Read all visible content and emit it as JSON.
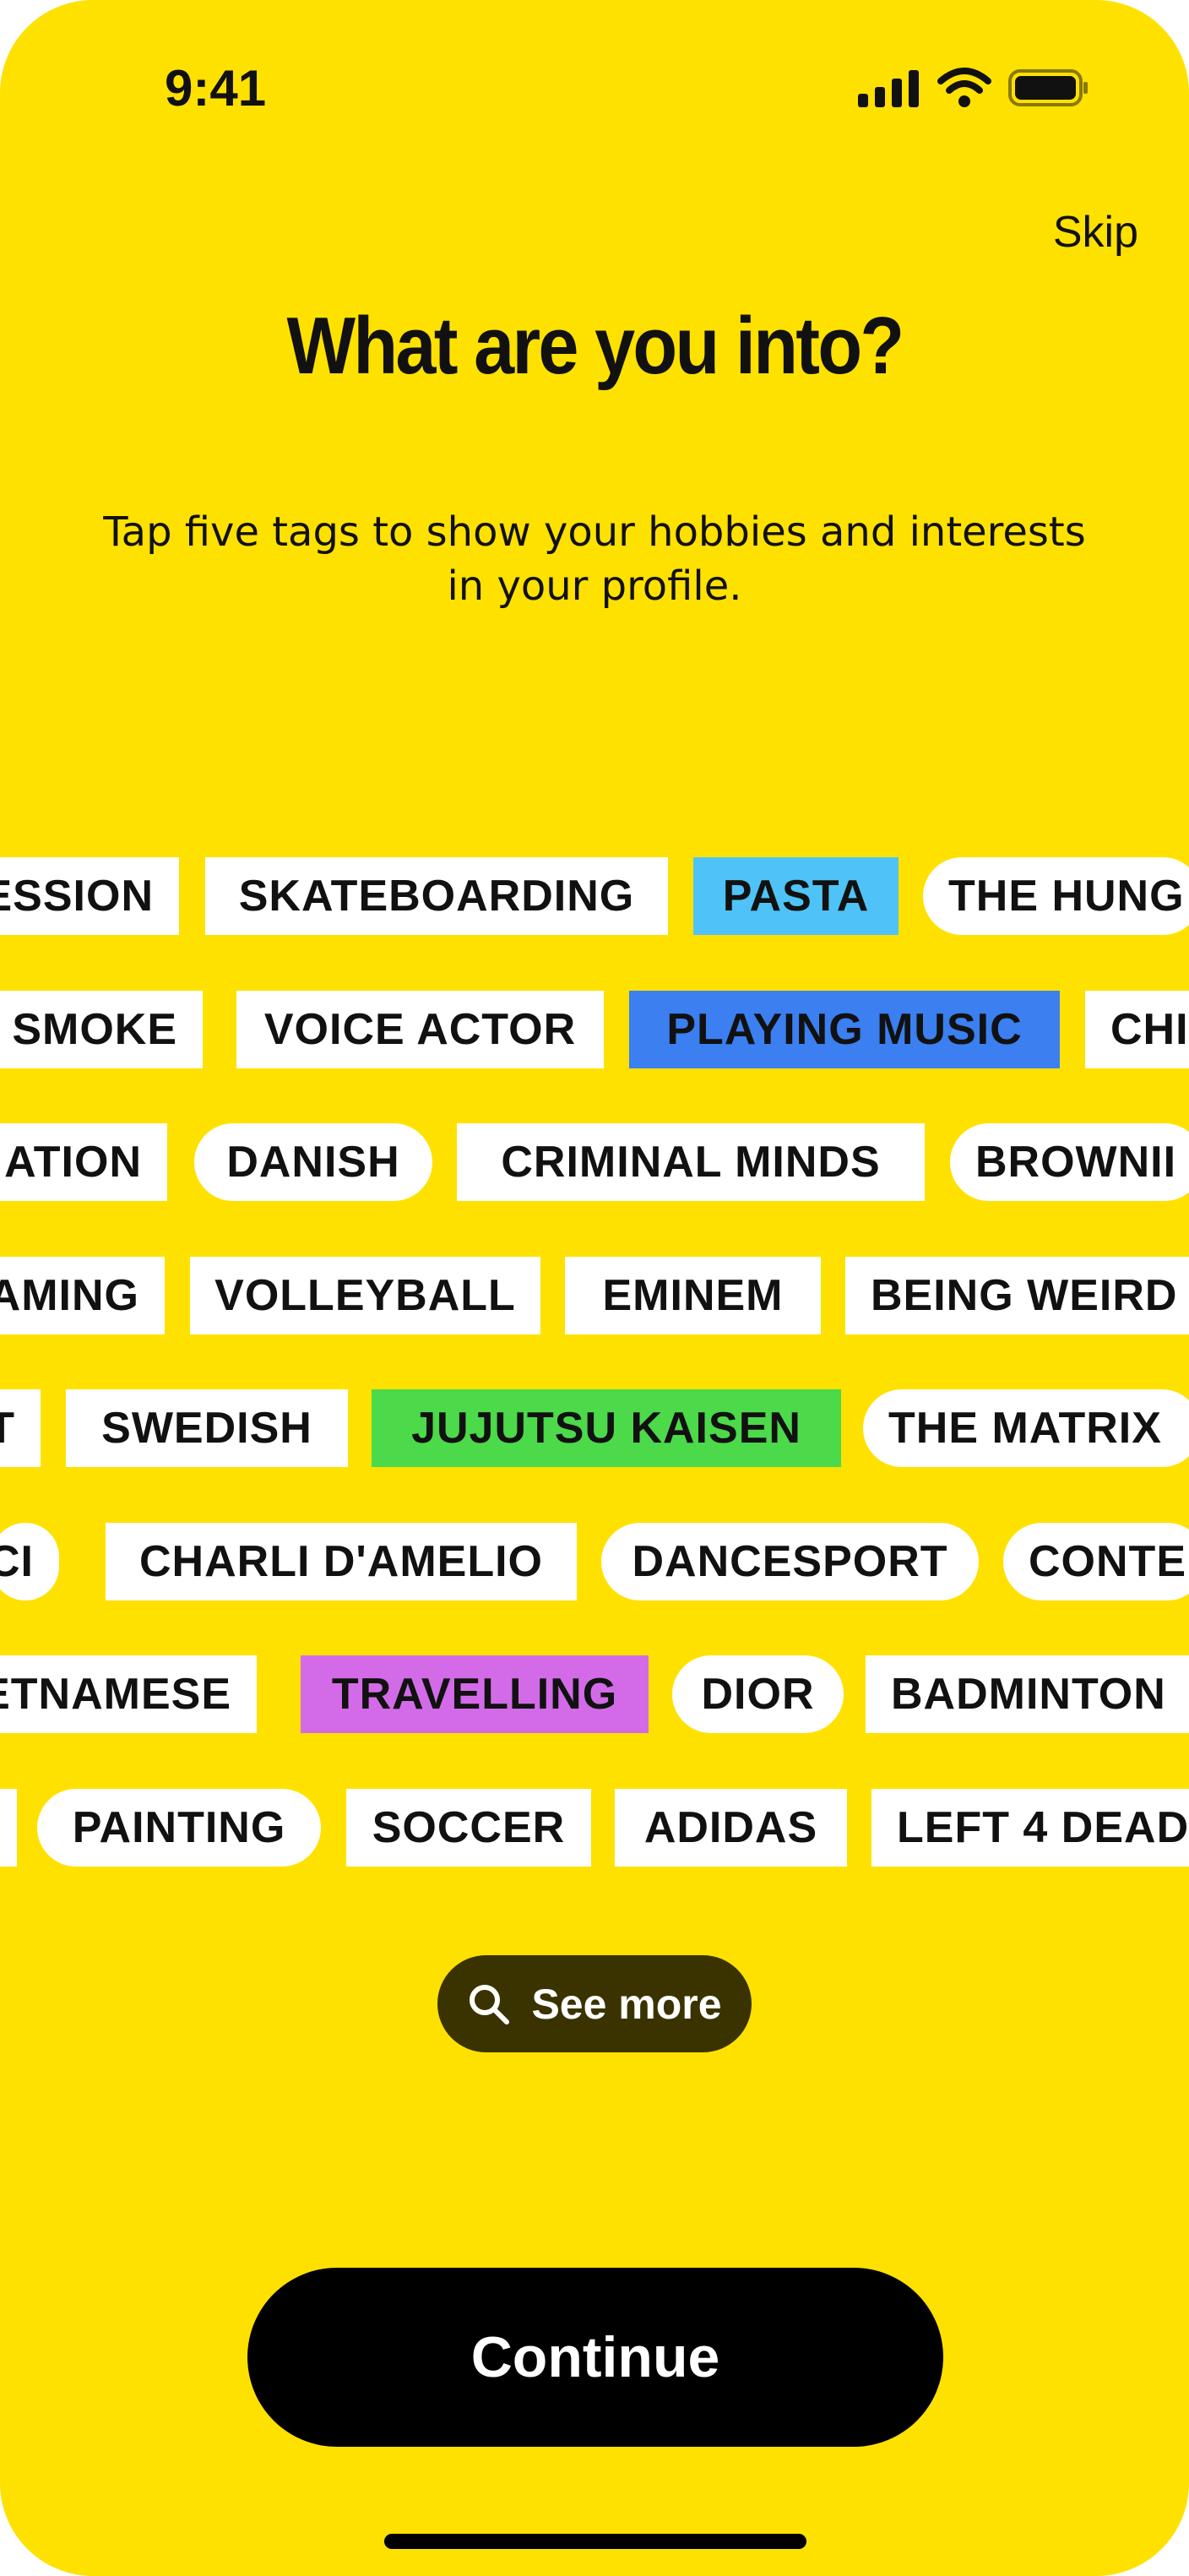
{
  "status_bar": {
    "time": "9:41"
  },
  "header": {
    "skip_label": "Skip",
    "title": "What are you into?",
    "subtitle": "Tap five tags to show your hobbies and interests in your profile."
  },
  "tag_rows": [
    [
      {
        "label": "ESSION",
        "shape": "rect",
        "color": "#ffffff"
      },
      {
        "label": "SKATEBOARDING",
        "shape": "rect",
        "color": "#ffffff"
      },
      {
        "label": "PASTA",
        "shape": "rect",
        "color": "#4fc3f7"
      },
      {
        "label": "THE HUNG",
        "shape": "pill",
        "color": "#ffffff"
      }
    ],
    [
      {
        "label": "SMOKE",
        "shape": "rect",
        "color": "#ffffff"
      },
      {
        "label": "VOICE ACTOR",
        "shape": "rect",
        "color": "#ffffff"
      },
      {
        "label": "PLAYING MUSIC",
        "shape": "rect",
        "color": "#3b7ff0"
      },
      {
        "label": "CHI",
        "shape": "rect",
        "color": "#ffffff"
      }
    ],
    [
      {
        "label": "ATION",
        "shape": "rect",
        "color": "#ffffff"
      },
      {
        "label": "DANISH",
        "shape": "pill",
        "color": "#ffffff"
      },
      {
        "label": "CRIMINAL MINDS",
        "shape": "rect",
        "color": "#ffffff"
      },
      {
        "label": "BROWNII",
        "shape": "pill",
        "color": "#ffffff"
      }
    ],
    [
      {
        "label": "AMING",
        "shape": "rect",
        "color": "#ffffff"
      },
      {
        "label": "VOLLEYBALL",
        "shape": "rect",
        "color": "#ffffff"
      },
      {
        "label": "EMINEM",
        "shape": "rect",
        "color": "#ffffff"
      },
      {
        "label": "BEING WEIRD",
        "shape": "rect",
        "color": "#ffffff"
      }
    ],
    [
      {
        "label": "T",
        "shape": "rect",
        "color": "#ffffff"
      },
      {
        "label": "SWEDISH",
        "shape": "rect",
        "color": "#ffffff"
      },
      {
        "label": "JUJUTSU KAISEN",
        "shape": "rect",
        "color": "#4cd94a"
      },
      {
        "label": "THE MATRIX",
        "shape": "pill",
        "color": "#ffffff"
      }
    ],
    [
      {
        "label": "CI",
        "shape": "pill",
        "color": "#ffffff"
      },
      {
        "label": "CHARLI D'AMELIO",
        "shape": "rect",
        "color": "#ffffff"
      },
      {
        "label": "DANCESPORT",
        "shape": "pill",
        "color": "#ffffff"
      },
      {
        "label": "CONTE",
        "shape": "pill",
        "color": "#ffffff"
      }
    ],
    [
      {
        "label": "ETNAMESE",
        "shape": "rect",
        "color": "#ffffff"
      },
      {
        "label": "TRAVELLING",
        "shape": "rect",
        "color": "#d36be8"
      },
      {
        "label": "DIOR",
        "shape": "pill",
        "color": "#ffffff"
      },
      {
        "label": "BADMINTON",
        "shape": "rect",
        "color": "#ffffff"
      }
    ],
    [
      {
        "label": "",
        "shape": "rect",
        "color": "#ffffff"
      },
      {
        "label": "PAINTING",
        "shape": "pill",
        "color": "#ffffff"
      },
      {
        "label": "SOCCER",
        "shape": "rect",
        "color": "#ffffff"
      },
      {
        "label": "ADIDAS",
        "shape": "rect",
        "color": "#ffffff"
      },
      {
        "label": "LEFT 4 DEAD",
        "shape": "rect",
        "color": "#ffffff"
      }
    ]
  ],
  "see_more": {
    "label": "See more",
    "icon": "search-icon"
  },
  "continue_label": "Continue",
  "colors": {
    "background": "#ffe100",
    "see_more_bg": "#3a3300",
    "continue_bg": "#000000"
  }
}
